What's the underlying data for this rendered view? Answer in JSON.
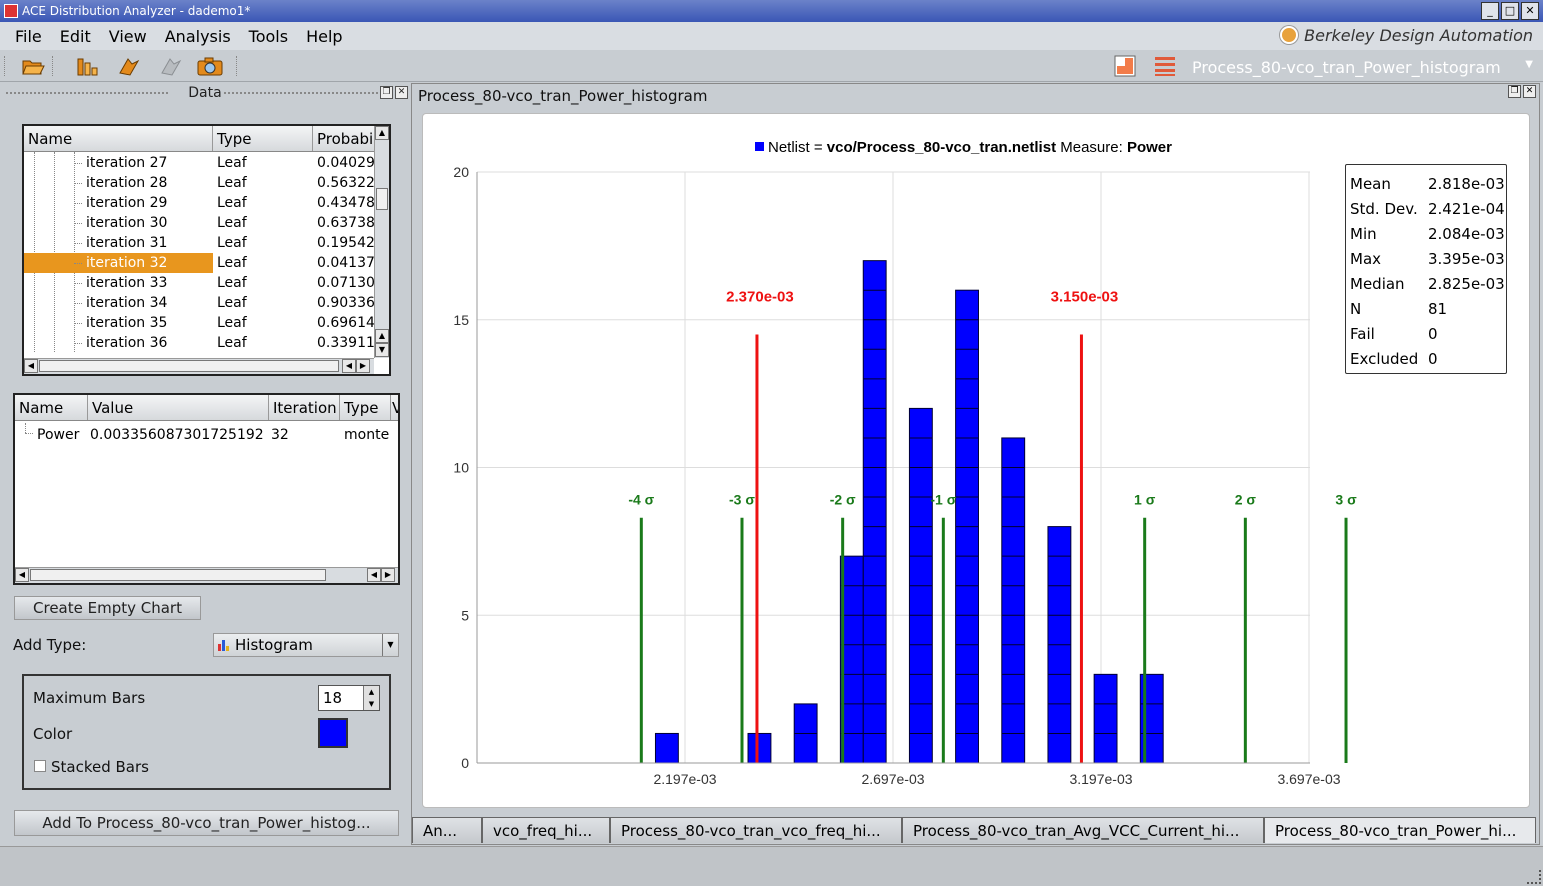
{
  "window": {
    "title": "ACE Distribution Analyzer - dademo1*",
    "buttons": [
      "_",
      "□",
      "✕"
    ]
  },
  "menu": [
    "File",
    "Edit",
    "View",
    "Analysis",
    "Tools",
    "Help"
  ],
  "brand": "Berkeley Design Automation",
  "toolbar": {
    "icons": [
      "open-folder-icon",
      "bar-chart-icon",
      "arrow-orange-icon",
      "arrow-gray-icon",
      "camera-icon"
    ],
    "chart_selector": "Process_80-vco_tran_Power_histogram"
  },
  "data_panel": {
    "title": "Data",
    "columns": [
      "Name",
      "Type",
      "Probabi"
    ],
    "rows": [
      {
        "name": "iteration 27",
        "type": "Leaf",
        "prob": "0.04029"
      },
      {
        "name": "iteration 28",
        "type": "Leaf",
        "prob": "0.56322"
      },
      {
        "name": "iteration 29",
        "type": "Leaf",
        "prob": "0.43478"
      },
      {
        "name": "iteration 30",
        "type": "Leaf",
        "prob": "0.63738"
      },
      {
        "name": "iteration 31",
        "type": "Leaf",
        "prob": "0.19542"
      },
      {
        "name": "iteration 32",
        "type": "Leaf",
        "prob": "0.04137",
        "selected": true
      },
      {
        "name": "iteration 33",
        "type": "Leaf",
        "prob": "0.07130"
      },
      {
        "name": "iteration 34",
        "type": "Leaf",
        "prob": "0.90336"
      },
      {
        "name": "iteration 35",
        "type": "Leaf",
        "prob": "0.69614"
      },
      {
        "name": "iteration 36",
        "type": "Leaf",
        "prob": "0.33911"
      }
    ]
  },
  "value_table": {
    "columns": [
      "Name",
      "Value",
      "Iteration",
      "Type",
      "V"
    ],
    "row": {
      "name": "Power",
      "value": "0.003356087301725192",
      "iteration": "32",
      "type": "monte"
    }
  },
  "controls": {
    "create_empty_chart": "Create Empty Chart",
    "add_type_label": "Add Type:",
    "add_type_value": "Histogram",
    "max_bars_label": "Maximum Bars",
    "max_bars_value": "18",
    "color_label": "Color",
    "color_value": "#0000ff",
    "stacked_bars_label": "Stacked Bars",
    "stacked_bars_checked": false,
    "add_to_button": "Add To Process_80-vco_tran_Power_histog..."
  },
  "chart_panel": {
    "title": "Process_80-vco_tran_Power_histogram",
    "legend_prefix": "Netlist = ",
    "legend_netlist": "vco/Process_80-vco_tran.netlist",
    "legend_measure_label": " Measure: ",
    "legend_measure": "Power"
  },
  "stats": [
    {
      "label": "Mean",
      "value": "2.818e-03"
    },
    {
      "label": "Std. Dev.",
      "value": "2.421e-04"
    },
    {
      "label": "Min",
      "value": "2.084e-03"
    },
    {
      "label": "Max",
      "value": "3.395e-03"
    },
    {
      "label": "Median",
      "value": "2.825e-03"
    },
    {
      "label": "N",
      "value": "81"
    },
    {
      "label": "Fail",
      "value": "0"
    },
    {
      "label": "Excluded",
      "value": "0"
    }
  ],
  "chart_data": {
    "type": "bar",
    "title": "",
    "legend": "Netlist = vco/Process_80-vco_tran.netlist Measure: Power",
    "xlabel": "",
    "ylabel": "",
    "xlim": [
      0.00201,
      0.00364
    ],
    "ylim": [
      0,
      20
    ],
    "yticks": [
      0,
      5,
      10,
      15,
      20
    ],
    "xticks": [
      0.002197,
      0.002697,
      0.003197,
      0.003697
    ],
    "xtick_labels": [
      "2.197e-03",
      "2.697e-03",
      "3.197e-03",
      "3.697e-03"
    ],
    "grid": true,
    "bar_color": "#0000ff",
    "bar_width": 5.5e-05,
    "bars": [
      {
        "x": 0.0021535,
        "count": 1
      },
      {
        "x": 0.002376,
        "count": 1
      },
      {
        "x": 0.002487,
        "count": 2
      },
      {
        "x": 0.002598,
        "count": 7
      },
      {
        "x": 0.002653,
        "count": 17
      },
      {
        "x": 0.002764,
        "count": 12
      },
      {
        "x": 0.002875,
        "count": 16
      },
      {
        "x": 0.002986,
        "count": 11
      },
      {
        "x": 0.003097,
        "count": 8
      },
      {
        "x": 0.003208,
        "count": 3
      },
      {
        "x": 0.003319,
        "count": 3
      }
    ],
    "sigma_lines": [
      {
        "x": 0.002092,
        "label": "-4 σ"
      },
      {
        "x": 0.002334,
        "label": "-3 σ"
      },
      {
        "x": 0.002576,
        "label": "-2 σ"
      },
      {
        "x": 0.002818,
        "label": "-1 σ"
      },
      {
        "x": 0.003302,
        "label": "1 σ"
      },
      {
        "x": 0.003544,
        "label": "2 σ"
      },
      {
        "x": 0.003786,
        "label": "3 σ"
      }
    ],
    "sigma_line_height": 8.3,
    "limit_lines": [
      {
        "x": 0.00237,
        "label": "2.370e-03"
      },
      {
        "x": 0.00315,
        "label": "3.150e-03"
      }
    ],
    "limit_line_height": 14.5
  },
  "tabs": [
    {
      "label": "An...",
      "active": false
    },
    {
      "label": "vco_freq_hi...",
      "active": false
    },
    {
      "label": "Process_80-vco_tran_vco_freq_hi...",
      "active": false
    },
    {
      "label": "Process_80-vco_tran_Avg_VCC_Current_hi...",
      "active": false
    },
    {
      "label": "Process_80-vco_tran_Power_hi...",
      "active": true
    }
  ]
}
